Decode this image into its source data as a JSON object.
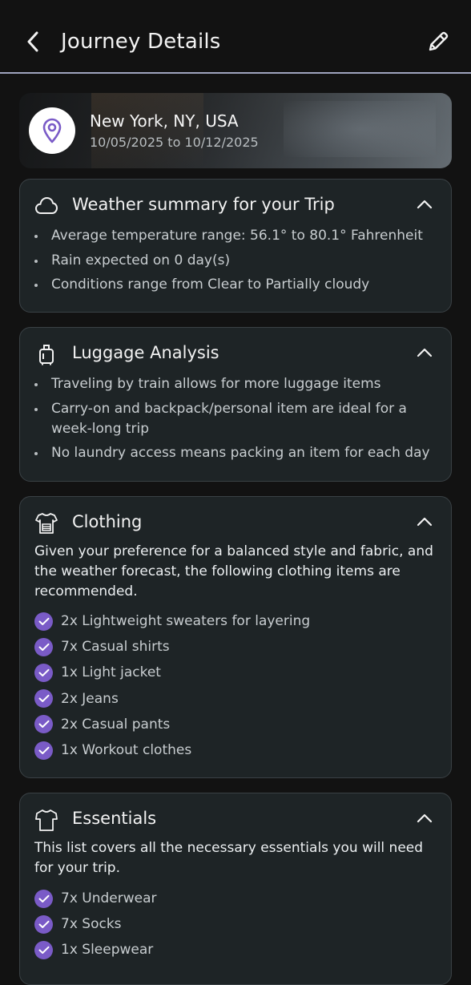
{
  "header": {
    "title": "Journey Details",
    "back_icon": "chevron-left-icon",
    "edit_icon": "pencil-icon"
  },
  "location": {
    "name": "New York, NY, USA",
    "dates": "10/05/2025 to 10/12/2025",
    "icon": "map-pin-icon"
  },
  "weather": {
    "title": "Weather summary for your Trip",
    "icon": "cloud-icon",
    "items": [
      "Average temperature range: 56.1° to 80.1° Fahrenheit",
      "Rain expected on 0 day(s)",
      "Conditions range from Clear to Partially cloudy"
    ]
  },
  "luggage": {
    "title": "Luggage Analysis",
    "icon": "suitcase-icon",
    "items": [
      "Traveling by train allows for more luggage items",
      "Carry-on and backpack/personal item are ideal for a week-long trip",
      "No laundry access means packing an item for each day"
    ]
  },
  "clothing": {
    "title": "Clothing",
    "icon": "clothing-icon",
    "description": "Given your preference for a balanced style and fabric, and the weather forecast, the following clothing items are recommended.",
    "items": [
      "2x Lightweight sweaters for layering",
      "7x Casual shirts",
      "1x Light jacket",
      "2x Jeans",
      "2x Casual pants",
      "1x Workout clothes"
    ]
  },
  "essentials": {
    "title": "Essentials",
    "icon": "shirt-icon",
    "description": "This list covers all the necessary essentials you will need for your trip.",
    "items": [
      "7x Underwear",
      "7x Socks",
      "1x Sleepwear"
    ]
  },
  "colors": {
    "background": "#121212",
    "card": "#1E2426",
    "accent": "#7A5BC7",
    "divider": "#9FA4BE"
  }
}
